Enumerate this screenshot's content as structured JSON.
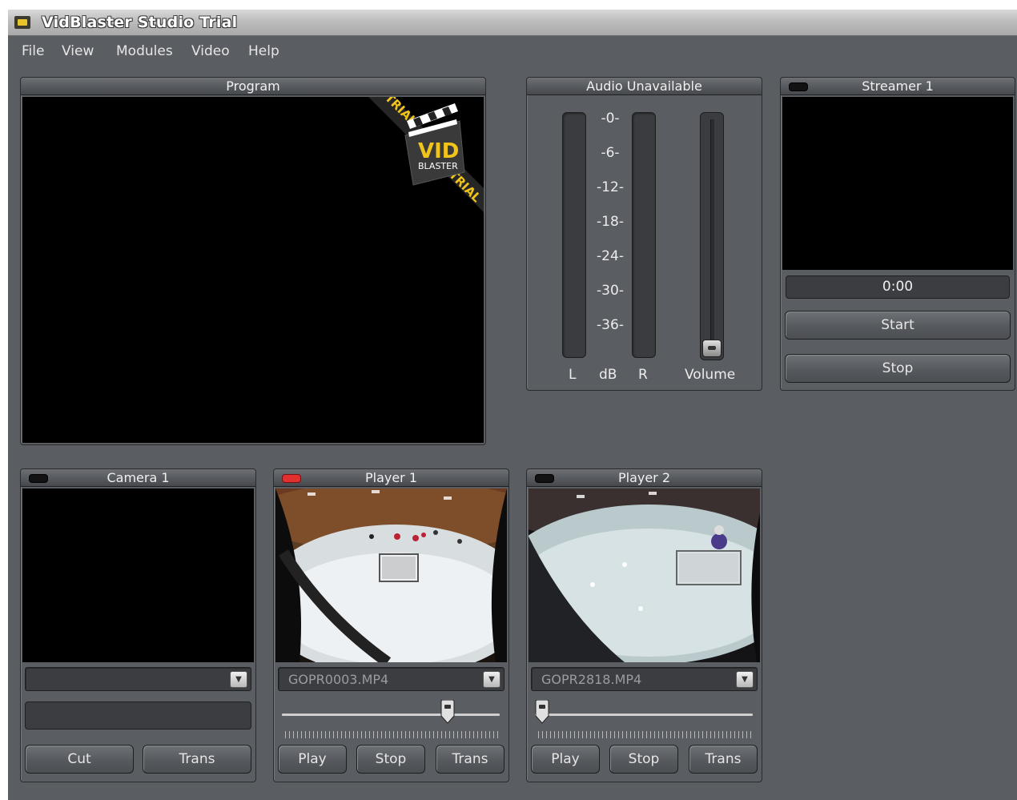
{
  "window": {
    "title": "VidBlaster Studio Trial"
  },
  "menu": [
    "File",
    "View",
    "Modules",
    "Video",
    "Help"
  ],
  "program": {
    "title": "Program",
    "watermark": {
      "logo_top": "VID",
      "logo_bottom": "BLASTER",
      "ribbon": "TRIAL"
    }
  },
  "audio": {
    "title": "Audio Unavailable",
    "scale": [
      "-0-",
      "-6-",
      "-12-",
      "-18-",
      "-24-",
      "-30-",
      "-36-"
    ],
    "left_label": "L",
    "unit_label": "dB",
    "right_label": "R",
    "volume_label": "Volume",
    "volume_level": 0
  },
  "streamer": {
    "title": "Streamer 1",
    "time": "0:00",
    "start_label": "Start",
    "stop_label": "Stop"
  },
  "camera": {
    "title": "Camera 1",
    "source": "",
    "cut_label": "Cut",
    "trans_label": "Trans"
  },
  "player1": {
    "title": "Player 1",
    "file": "GOPR0003.MP4",
    "position": 0.78,
    "play_label": "Play",
    "stop_label": "Stop",
    "trans_label": "Trans",
    "live": true
  },
  "player2": {
    "title": "Player 2",
    "file": "GOPR2818.MP4",
    "position": 0.0,
    "play_label": "Play",
    "stop_label": "Stop",
    "trans_label": "Trans",
    "live": false
  },
  "colors": {
    "background": "#5a5d61",
    "live_led": "#e03030",
    "logo_yellow": "#f0c419"
  }
}
